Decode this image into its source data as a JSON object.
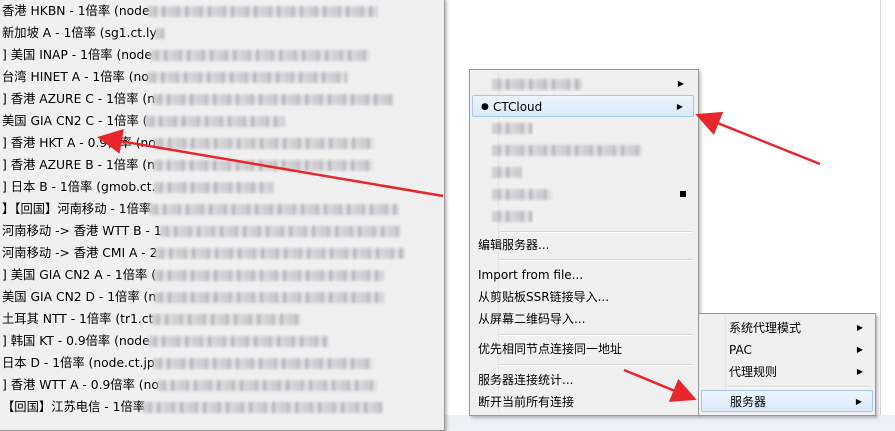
{
  "server_list": [
    {
      "text": "香港 HKBN - 1倍率 (node",
      "blur": 230
    },
    {
      "text": "新加坡 A - 1倍率 (sg1.ct.ly",
      "blur": 10
    },
    {
      "text": "] 美国 INAP - 1倍率 (node",
      "blur": 220
    },
    {
      "text": "台湾 HINET A - 1倍率 (no",
      "blur": 200
    },
    {
      "text": "] 香港 AZURE C - 1倍率 (n",
      "blur": 240
    },
    {
      "text": "美国 GIA CN2 C - 1倍率 (",
      "blur": 140
    },
    {
      "text": "] 香港 HKT A - 0.9倍率 (no",
      "blur": 220
    },
    {
      "text": "] 香港 AZURE B - 1倍率 (n",
      "blur": 220
    },
    {
      "text": "] 日本 B - 1倍率 (gmob.ct.",
      "blur": 120
    },
    {
      "text": "】【回国】河南移动 - 1倍率",
      "blur": 250
    },
    {
      "text": "河南移动 -> 香港 WTT B - 1",
      "blur": 240
    },
    {
      "text": "河南移动 -> 香港 CMI A - 2",
      "blur": 250
    },
    {
      "text": "] 美国 GIA CN2 A - 1倍率 (",
      "blur": 230
    },
    {
      "text": "美国 GIA CN2 D - 1倍率 (n",
      "blur": 230
    },
    {
      "text": "土耳其 NTT - 1倍率 (tr1.ct",
      "blur": 150
    },
    {
      "text": "] 韩国 KT - 0.9倍率 (node",
      "blur": 180
    },
    {
      "text": "日本 D - 1倍率 (node.ct.jp",
      "blur": 220
    },
    {
      "text": "] 香港 WTT A - 0.9倍率 (no",
      "blur": 220
    },
    {
      "text": "【回国】江苏电信 - 1倍率",
      "blur": 240
    }
  ],
  "server_submenu": {
    "groups": [
      {
        "label": "",
        "blur": 90,
        "marker": "arrow"
      },
      {
        "label": "CTCloud",
        "bullet": "●",
        "marker": "arrow",
        "highlighted": true
      },
      {
        "label": "",
        "blur": 40,
        "marker": "none"
      },
      {
        "label": "",
        "blur": 150,
        "marker": "none"
      },
      {
        "label": "",
        "blur": 30,
        "marker": "none"
      },
      {
        "label": "",
        "blur": 60,
        "marker": "square"
      },
      {
        "label": "",
        "blur": 40,
        "marker": "none"
      }
    ],
    "edit_servers": "编辑服务器...",
    "import_from_file": "Import from file...",
    "import_clipboard": "从剪贴板SSR链接导入...",
    "import_qr": "从屏幕二维码导入...",
    "prefer_same_node": "优先相同节点连接同一地址",
    "server_stats": "服务器连接统计...",
    "disconnect_all": "断开当前所有连接"
  },
  "tray_menu": {
    "system_proxy_mode": "系统代理模式",
    "pac": "PAC",
    "proxy_rules": "代理规则",
    "servers": "服务器"
  },
  "colors": {
    "arrow": "#e8262b",
    "menu_bg": "#f0f0f0",
    "highlight": "#dbe9f9"
  },
  "icons": {
    "submenu": "triangle-right",
    "selected": "bullet",
    "checked": "square"
  }
}
